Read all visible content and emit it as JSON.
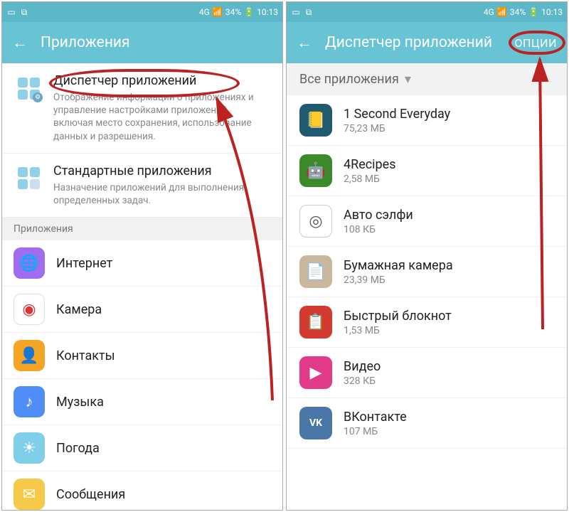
{
  "status": {
    "network": "4G",
    "battery": "34%",
    "time": "10:13"
  },
  "left": {
    "title": "Приложения",
    "sections": [
      {
        "title": "Диспетчер приложений",
        "desc": "Отображение информации о приложениях и управление настройками приложений, включая место сохранения, использование данных и разрешения."
      },
      {
        "title": "Стандартные приложения",
        "desc": "Назначение приложений для выполнения определенных задач."
      }
    ],
    "group_label": "Приложения",
    "apps": [
      {
        "name": "Интернет",
        "icon": "globe",
        "bg": "#a06cf0"
      },
      {
        "name": "Камера",
        "icon": "camera",
        "bg": "#ffffff"
      },
      {
        "name": "Контакты",
        "icon": "person",
        "bg": "#f5a423"
      },
      {
        "name": "Музыка",
        "icon": "note",
        "bg": "#4f8df7"
      },
      {
        "name": "Погода",
        "icon": "sun",
        "bg": "#7fcfe8"
      },
      {
        "name": "Сообщения",
        "icon": "mail",
        "bg": "#f7c948"
      }
    ]
  },
  "right": {
    "title": "Диспетчер приложений",
    "options_label": "ОПЦИИ",
    "filter_label": "Все приложения",
    "apps": [
      {
        "name": "1 Second Everyday",
        "size": "75,23 МБ",
        "bg": "#1f5a6e",
        "glyph": "📘"
      },
      {
        "name": "4Recipes",
        "size": "2,58 МБ",
        "bg": "#3a8a2a",
        "glyph": "🤖"
      },
      {
        "name": "Авто сэлфи",
        "size": "108 КБ",
        "bg": "#ffffff",
        "glyph": "◎"
      },
      {
        "name": "Бумажная камера",
        "size": "23,39 МБ",
        "bg": "#c9b79e",
        "glyph": "📄"
      },
      {
        "name": "Быстрый блокнот",
        "size": "1,53 МБ",
        "bg": "#d23a2f",
        "glyph": "📋"
      },
      {
        "name": "Видео",
        "size": "328 КБ",
        "bg": "#e23a8a",
        "glyph": "▶"
      },
      {
        "name": "ВКонтакте",
        "size": "107 МБ",
        "bg": "#4a76a8",
        "glyph": "VK"
      }
    ]
  }
}
